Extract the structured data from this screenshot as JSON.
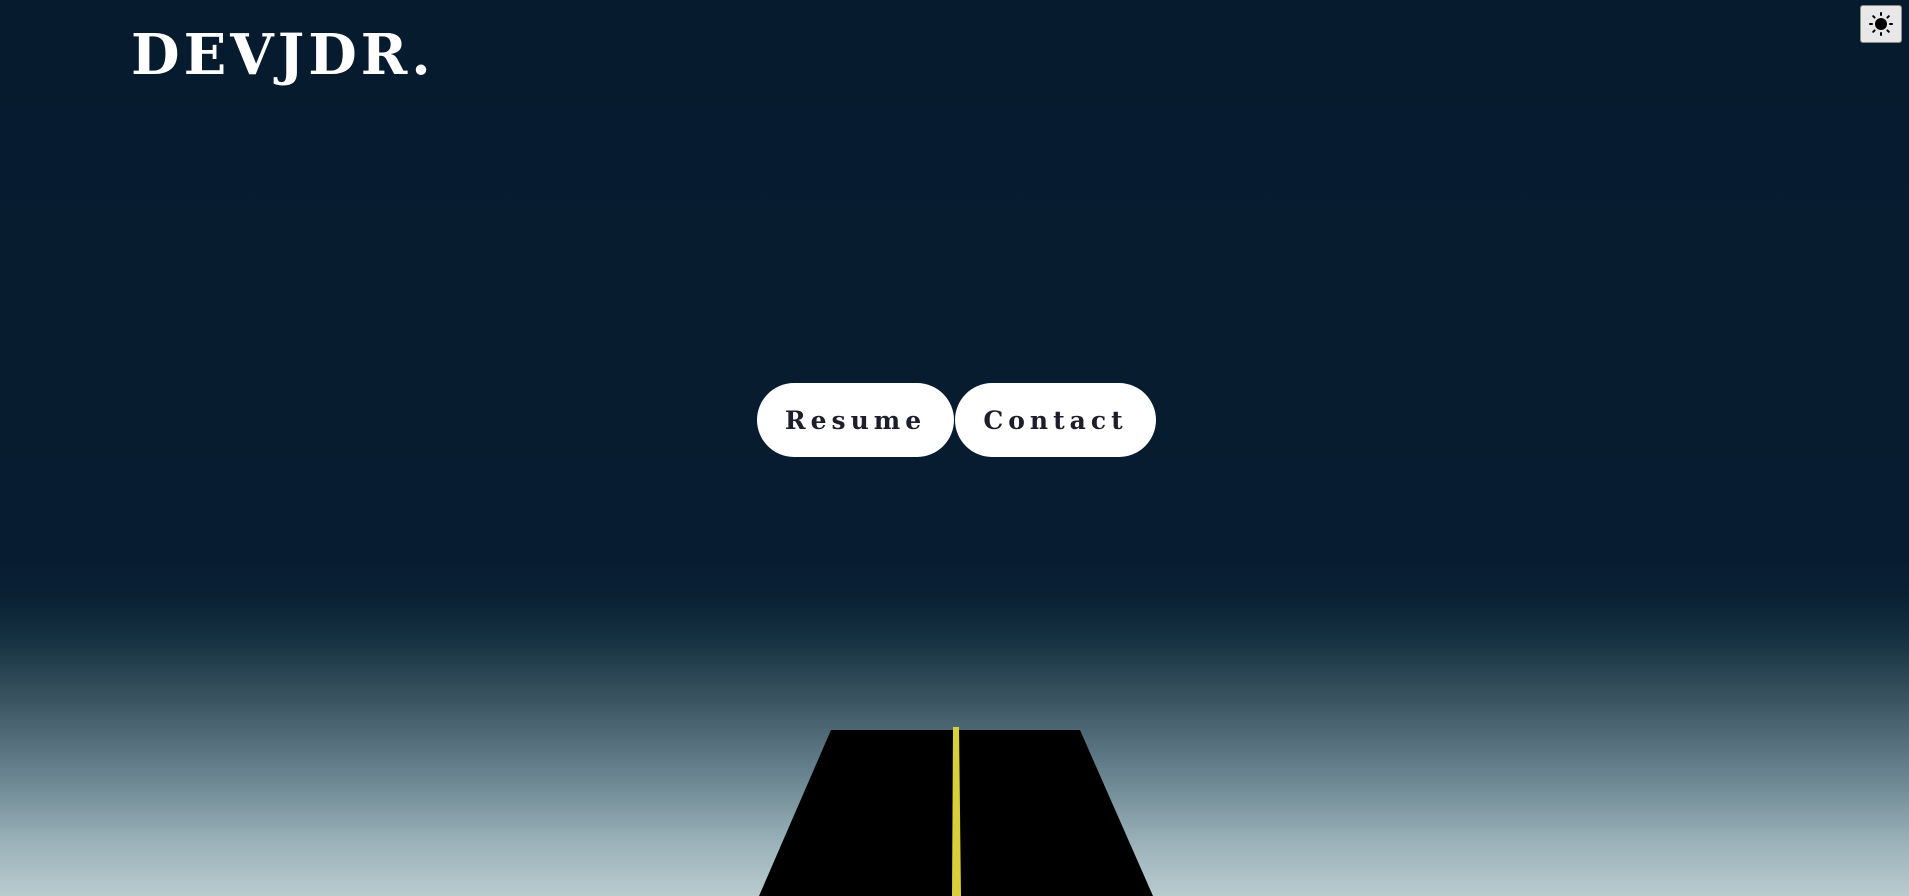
{
  "header": {
    "logo_text": "DEVJDR."
  },
  "theme_toggle": {
    "icon": "sun-icon"
  },
  "hero": {
    "buttons": [
      {
        "label": "Resume"
      },
      {
        "label": "Contact"
      }
    ]
  },
  "scene": {
    "road_color": "#000000",
    "center_line_color": "#d8cf3a",
    "sky_color": "#081c30",
    "horizon_glow_color": "#b9cbcf"
  }
}
